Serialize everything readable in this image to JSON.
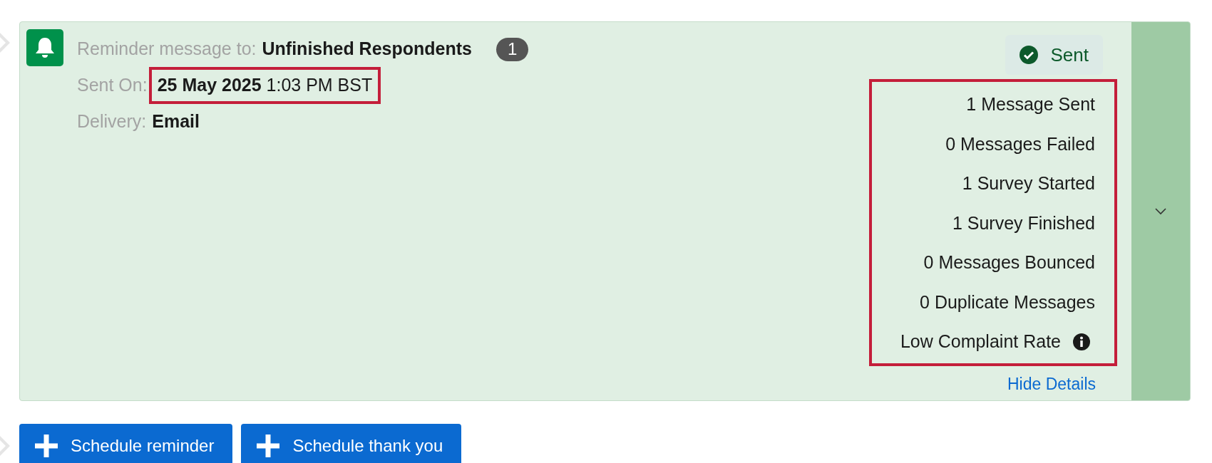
{
  "message": {
    "label": "Reminder message to:",
    "recipients": "Unfinished Respondents",
    "count": "1"
  },
  "sent_on": {
    "label": "Sent On:",
    "value": "**25 May 2025** 1:03 PM BST",
    "highlighted": true
  },
  "delivery": {
    "label": "Delivery:",
    "value": "Email"
  },
  "status": {
    "text": "Sent"
  },
  "stats": {
    "highlighted": true,
    "items": [
      {
        "text": "1 Message Sent",
        "kind": "plain"
      },
      {
        "text": "0 Messages Failed",
        "kind": "plain"
      },
      {
        "text": "1 Survey Started",
        "kind": "plain"
      },
      {
        "text": "1 Survey Finished",
        "kind": "plain"
      },
      {
        "text": "0 Messages Bounced",
        "kind": "plain"
      },
      {
        "text": "0 Duplicate Messages",
        "kind": "plain"
      },
      {
        "text": "Low Complaint Rate",
        "kind": "info"
      }
    ]
  },
  "hide_details": "Hide Details",
  "buttons": [
    "Schedule reminder",
    "Schedule thank you"
  ]
}
